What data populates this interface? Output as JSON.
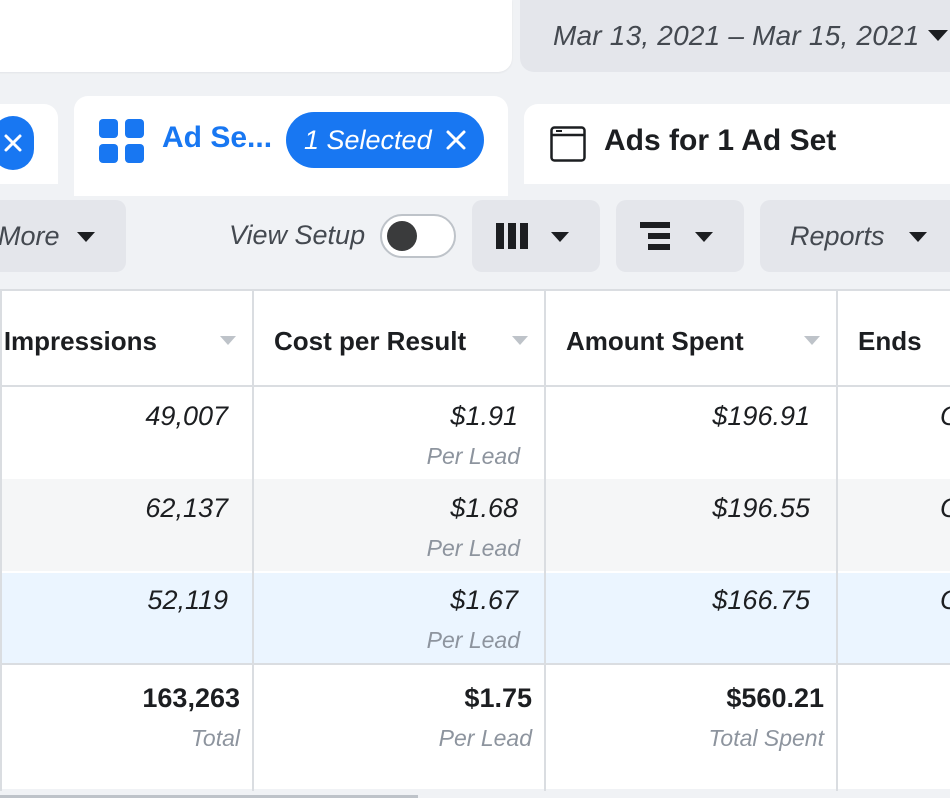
{
  "date_range": {
    "label": "Mar 13, 2021 – Mar 15, 2021"
  },
  "tabs": {
    "active": {
      "label": "Ad Se...",
      "selected_label": "1 Selected"
    },
    "ads": {
      "label": "Ads for 1 Ad Set"
    }
  },
  "toolbar": {
    "more_label": "More",
    "view_setup_label": "View Setup",
    "reports_label": "Reports"
  },
  "table": {
    "headers": {
      "impressions": "Impressions",
      "cost_per_result": "Cost per Result",
      "amount_spent": "Amount Spent",
      "ends": "Ends"
    },
    "rows": [
      {
        "impressions": "49,007",
        "cost": "$1.91",
        "cost_sub": "Per Lead",
        "spent": "$196.91",
        "ends": "O"
      },
      {
        "impressions": "62,137",
        "cost": "$1.68",
        "cost_sub": "Per Lead",
        "spent": "$196.55",
        "ends": "O"
      },
      {
        "impressions": "52,119",
        "cost": "$1.67",
        "cost_sub": "Per Lead",
        "spent": "$166.75",
        "ends": "O"
      }
    ],
    "totals": {
      "impressions": "163,263",
      "impressions_sub": "Total",
      "cost": "$1.75",
      "cost_sub": "Per Lead",
      "spent": "$560.21",
      "spent_sub": "Total Spent"
    }
  },
  "colors": {
    "accent": "#1877f2",
    "row_alt": "#f5f6f7",
    "row_selected": "#ebf5ff",
    "button_bg": "#e4e6eb"
  }
}
